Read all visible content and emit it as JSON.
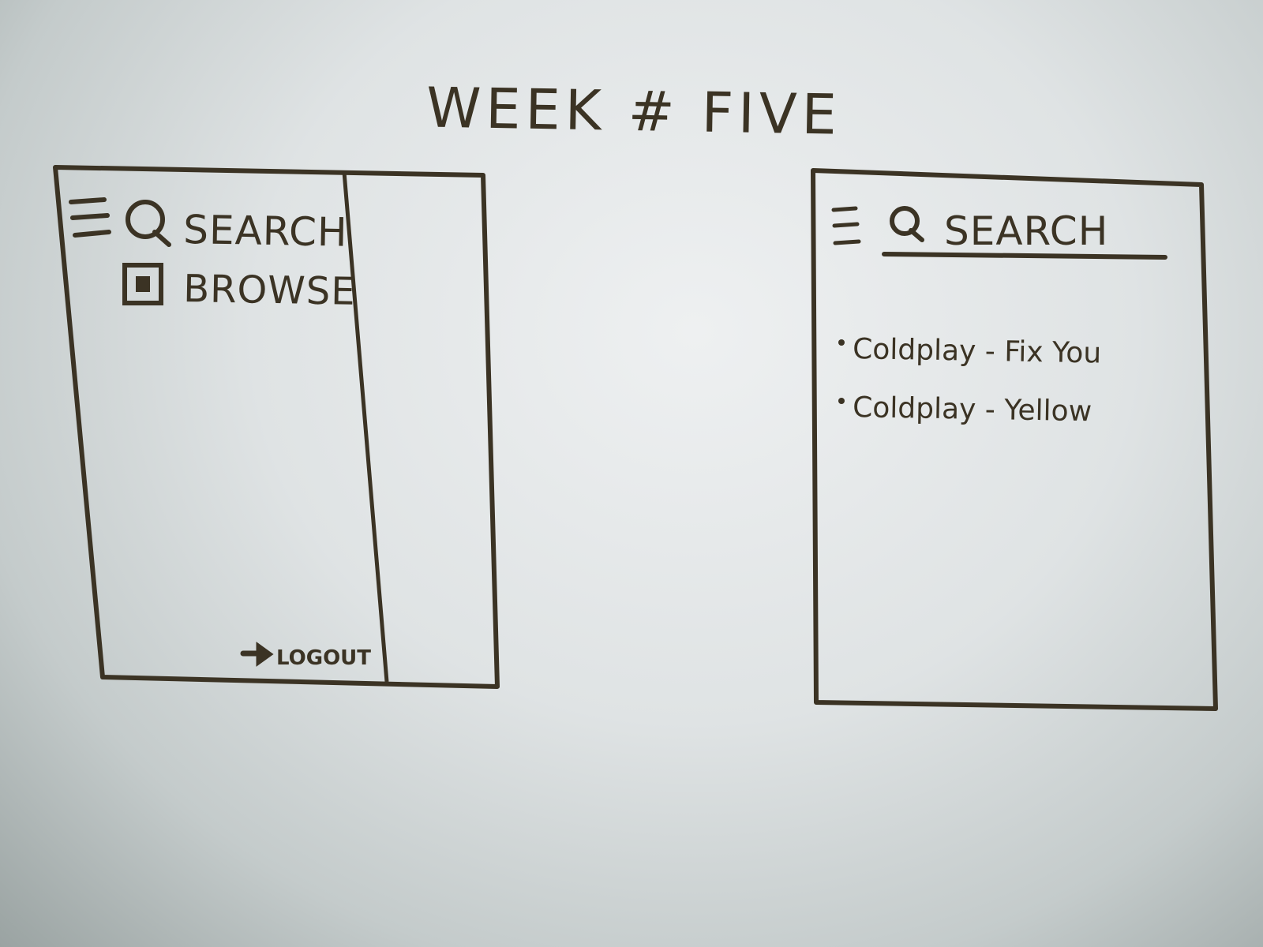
{
  "title": "WEEK # FIVE",
  "left_screen": {
    "menu_icon": "hamburger-icon",
    "search_icon": "search-icon",
    "search_label": "SEARCH",
    "browse_icon": "browse-icon",
    "browse_label": "BROWSE",
    "logout_icon": "arrow-right-icon",
    "logout_label": "LOGOUT"
  },
  "right_screen": {
    "menu_icon": "hamburger-icon",
    "search_icon": "search-icon",
    "search_label": "SEARCH",
    "results": [
      "Coldplay - Fix You",
      "Coldplay - Yellow"
    ]
  },
  "colors": {
    "ink": "#3b3324",
    "paper": "#e3e6e7"
  }
}
